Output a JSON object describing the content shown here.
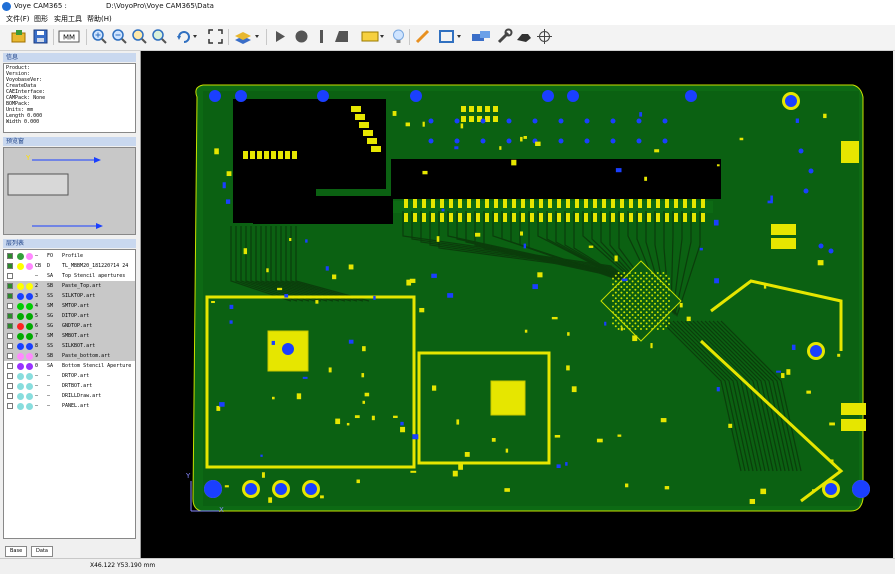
{
  "window": {
    "app_name": "Voye CAM365 :",
    "path": "D:\\VoyoPro\\Voye CAM365\\Data"
  },
  "menu": [
    "文件(F)",
    "图形",
    "实用工具",
    "帮助(H)"
  ],
  "toolbar": {
    "buttons": [
      "open-icon",
      "save-icon",
      "mm-unit-icon",
      "zoom-in-icon",
      "zoom-out-icon",
      "zoom-window-icon",
      "zoom-all-icon",
      "rotate-icon",
      "fit-icon",
      "layer-color-icon",
      "point-icon",
      "line-icon",
      "polygon-icon",
      "pad-icon",
      "bulb-icon",
      "pencil-icon",
      "rect-icon",
      "measure-icon",
      "wrench-icon",
      "target-icon"
    ],
    "unit_label": "MM"
  },
  "info_panel": {
    "title": "信息",
    "lines": [
      "Product:",
      "Version:",
      "VoyobaseVer:",
      "CreateData",
      "CAEInterface:",
      "CAMPack: None",
      "BOMPack:",
      "Units: mm",
      "Length 0.000",
      "Width 0.000"
    ]
  },
  "preview_panel": {
    "title": "预览窗",
    "axis_label": "Y"
  },
  "layers_panel": {
    "title": "层列表",
    "layers": [
      {
        "checked": true,
        "c1": "#34a03c",
        "c2": "#ff88ff",
        "num": "—",
        "type": "FO",
        "name": "Profile",
        "selected": false
      },
      {
        "checked": true,
        "c1": "#ffff00",
        "c2": "#ff88ff",
        "num": "CB",
        "type": "D",
        "name": "TL_MBBM20_181220?1­4 24",
        "selected": false
      },
      {
        "checked": false,
        "c1": "#ffffff",
        "c2": "#ffffff",
        "num": "—",
        "type": "SA",
        "name": "Top Stencil apertures",
        "selected": false
      },
      {
        "checked": true,
        "c1": "#ffff00",
        "c2": "#ffff00",
        "num": "2",
        "type": "SB",
        "name": "Paste_Top.art",
        "selected": true
      },
      {
        "checked": true,
        "c1": "#1a3fff",
        "c2": "#1a3fff",
        "num": "3",
        "type": "SS",
        "name": "SILKTOP.art",
        "selected": true
      },
      {
        "checked": false,
        "c1": "#00cc00",
        "c2": "#00cc00",
        "num": "4",
        "type": "SM",
        "name": "SMTOP.art",
        "selected": true
      },
      {
        "checked": true,
        "c1": "#00aa00",
        "c2": "#00aa00",
        "num": "5",
        "type": "SG",
        "name": "DITOP.art",
        "selected": true
      },
      {
        "checked": true,
        "c1": "#ff2222",
        "c2": "#00aa00",
        "num": "6",
        "type": "SG",
        "name": "GNDTOP.art",
        "selected": true
      },
      {
        "checked": false,
        "c1": "#00aa00",
        "c2": "#00aa00",
        "num": "7",
        "type": "SM",
        "name": "SMBOT.art",
        "selected": true
      },
      {
        "checked": false,
        "c1": "#1a3fff",
        "c2": "#1a3fff",
        "num": "8",
        "type": "SS",
        "name": "SILKBOT.art",
        "selected": true
      },
      {
        "checked": false,
        "c1": "#ff88ff",
        "c2": "#ff88ff",
        "num": "9",
        "type": "SB",
        "name": "Paste_bottom.art",
        "selected": true
      },
      {
        "checked": false,
        "c1": "#9933ff",
        "c2": "#9933ff",
        "num": "0",
        "type": "SA",
        "name": "Bottom Stencil Aperture",
        "selected": false
      },
      {
        "checked": false,
        "c1": "#88dddd",
        "c2": "#88dddd",
        "num": "—",
        "type": "—",
        "name": "DRTOP.art",
        "selected": false
      },
      {
        "checked": false,
        "c1": "#88dddd",
        "c2": "#88dddd",
        "num": "—",
        "type": "—",
        "name": "DRTBOT.art",
        "selected": false
      },
      {
        "checked": false,
        "c1": "#88dddd",
        "c2": "#88dddd",
        "num": "—",
        "type": "—",
        "name": "DRILLDraw.art",
        "selected": false
      },
      {
        "checked": false,
        "c1": "#88dddd",
        "c2": "#88dddd",
        "num": "—",
        "type": "—",
        "name": "PANEL.art",
        "selected": false
      }
    ]
  },
  "tabs": [
    "Base",
    "Data"
  ],
  "canvas": {
    "axis_y": "Y",
    "axis_x": "X"
  },
  "status": {
    "coords": "X46.122 Y53.190 mm"
  }
}
